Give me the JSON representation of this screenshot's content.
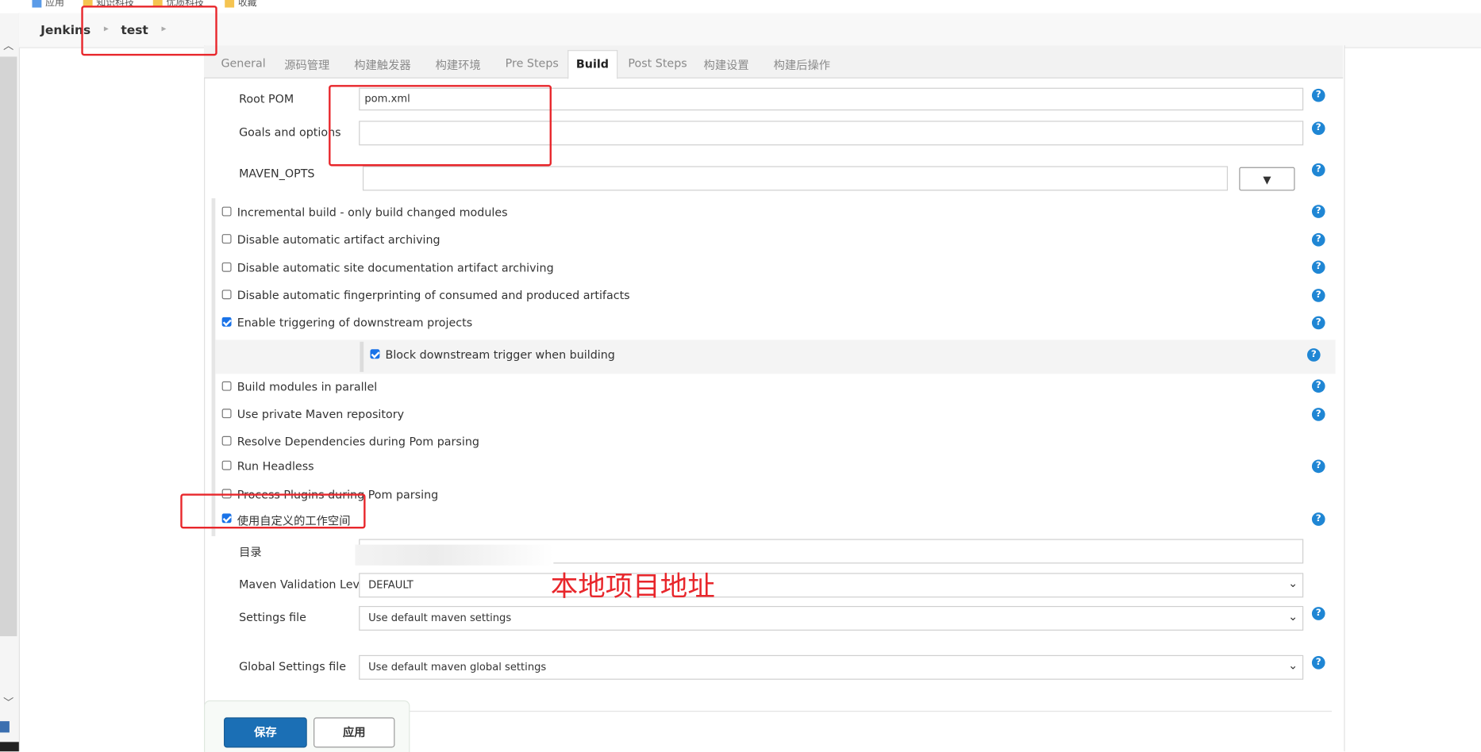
{
  "bookmarks": [
    {
      "label": "应用"
    },
    {
      "label": "知识科技"
    },
    {
      "label": "优质科技"
    },
    {
      "label": "收藏"
    }
  ],
  "breadcrumb": {
    "root": "Jenkins",
    "project": "test"
  },
  "tabs": [
    {
      "label": "General"
    },
    {
      "label": "源码管理"
    },
    {
      "label": "构建触发器"
    },
    {
      "label": "构建环境"
    },
    {
      "label": "Pre Steps"
    },
    {
      "label": "Build"
    },
    {
      "label": "Post Steps"
    },
    {
      "label": "构建设置"
    },
    {
      "label": "构建后操作"
    }
  ],
  "active_tab": "Build",
  "build": {
    "root_pom_label": "Root POM",
    "root_pom_value": "pom.xml",
    "goals_label": "Goals and options",
    "goals_value": "",
    "maven_opts_label": "MAVEN_OPTS",
    "maven_opts_value": "",
    "maven_opts_dropdown": "▼",
    "options": [
      {
        "label": "Incremental build - only build changed modules",
        "checked": false
      },
      {
        "label": "Disable automatic artifact archiving",
        "checked": false
      },
      {
        "label": "Disable automatic site documentation artifact archiving",
        "checked": false
      },
      {
        "label": "Disable automatic fingerprinting of consumed and produced artifacts",
        "checked": false
      },
      {
        "label": "Enable triggering of downstream projects",
        "checked": true
      },
      {
        "label": "Block downstream trigger when building",
        "checked": true
      },
      {
        "label": "Build modules in parallel",
        "checked": false
      },
      {
        "label": "Use private Maven repository",
        "checked": false
      },
      {
        "label": "Resolve Dependencies during Pom parsing",
        "checked": false
      },
      {
        "label": "Run Headless",
        "checked": false
      },
      {
        "label": "Process Plugins during Pom parsing",
        "checked": false
      },
      {
        "label": "使用自定义的工作空间",
        "checked": true
      }
    ],
    "directory_label": "目录",
    "directory_value": "",
    "validation_label": "Maven Validation Level",
    "validation_value": "DEFAULT",
    "settings_label": "Settings file",
    "settings_value": "Use default maven settings",
    "global_settings_label": "Global Settings file",
    "global_settings_value": "Use default maven global settings"
  },
  "annotation": {
    "text": "本地项目地址",
    "color": "#e8262b"
  },
  "footer": {
    "save_label": "保存",
    "apply_label": "应用"
  },
  "help_glyph": "?",
  "colors": {
    "accent": "#1f86d4",
    "save": "#1b6fb5",
    "annotation": "#e8262b"
  }
}
